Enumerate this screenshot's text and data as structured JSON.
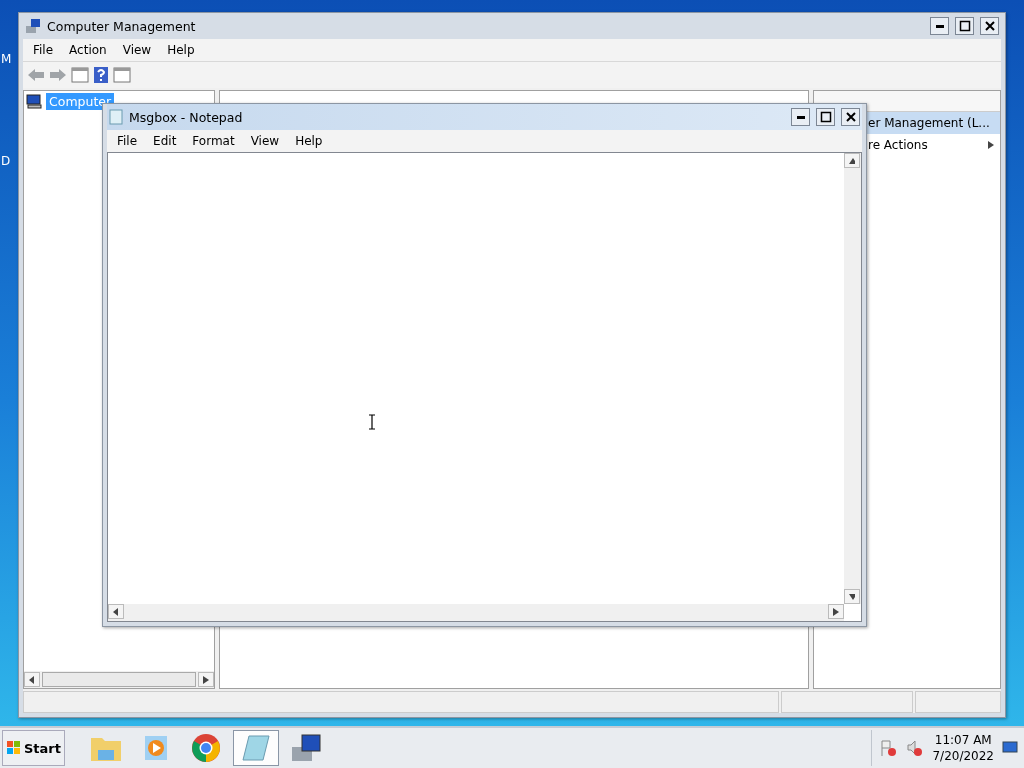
{
  "desktop": {
    "icon_labels": [
      "M",
      "D"
    ]
  },
  "main_window": {
    "title": "Computer Management",
    "menu": [
      "File",
      "Action",
      "View",
      "Help"
    ],
    "tree": [
      {
        "label": "Computer",
        "selected": true
      }
    ],
    "actions": [
      {
        "label": "er Management (L...",
        "selected": true,
        "kind": "header"
      },
      {
        "label": "re Actions",
        "selected": false,
        "kind": "submenu"
      }
    ]
  },
  "notepad": {
    "title": "Msgbox - Notepad",
    "menu": [
      "File",
      "Edit",
      "Format",
      "View",
      "Help"
    ]
  },
  "taskbar": {
    "start": "Start",
    "apps": [
      {
        "kind": "explorer",
        "selected": false
      },
      {
        "kind": "media",
        "selected": false
      },
      {
        "kind": "chrome",
        "selected": false
      },
      {
        "kind": "notepad",
        "selected": true
      },
      {
        "kind": "compmgmt",
        "selected": false
      }
    ],
    "time": "11:07 AM",
    "date": "7/20/2022"
  }
}
